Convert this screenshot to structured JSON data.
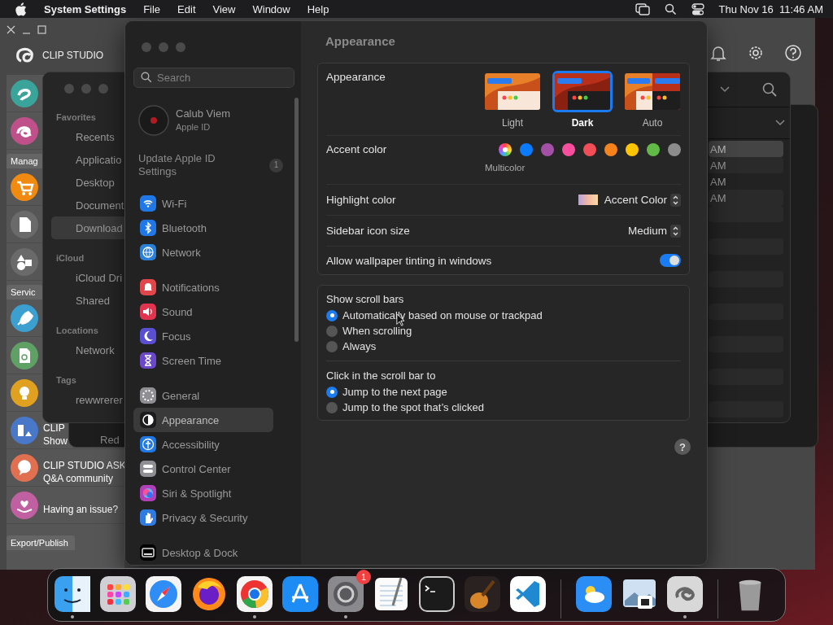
{
  "menu_bar": {
    "app": "System Settings",
    "menus": [
      "File",
      "Edit",
      "View",
      "Window",
      "Help"
    ],
    "clock": "Thu Nov 16  11:46 AM"
  },
  "clip_studio": {
    "title": "CLIP STUDIO",
    "items": [
      {
        "kind": "app"
      },
      {
        "kind": "app"
      },
      {
        "kind": "tab",
        "label": "Manag"
      },
      {
        "kind": "app"
      },
      {
        "kind": "app"
      },
      {
        "kind": "app"
      },
      {
        "kind": "tab",
        "label": "Servic"
      },
      {
        "kind": "app"
      },
      {
        "kind": "app"
      },
      {
        "kind": "app"
      },
      {
        "kind": "entry",
        "title": "CLIP",
        "subtitle": "Show"
      },
      {
        "kind": "entry",
        "title": "CLIP STUDIO ASK",
        "subtitle": "Q&A community"
      },
      {
        "kind": "entry",
        "title": "Having an issue?"
      },
      {
        "kind": "tab",
        "label": "Export/Publish"
      }
    ]
  },
  "finder": {
    "sections": [
      {
        "title": "Favorites",
        "items": [
          {
            "label": "Recents",
            "selected": false
          },
          {
            "label": "Applicatio",
            "selected": false
          },
          {
            "label": "Desktop",
            "selected": false
          },
          {
            "label": "Document",
            "selected": false
          },
          {
            "label": "Download",
            "selected": true
          }
        ]
      },
      {
        "title": "iCloud",
        "items": [
          {
            "label": "iCloud Dri",
            "selected": false
          },
          {
            "label": "Shared",
            "selected": false
          }
        ]
      },
      {
        "title": "Locations",
        "items": [
          {
            "label": "Network",
            "selected": false
          }
        ]
      },
      {
        "title": "Tags",
        "items": [
          {
            "label": "rewwrerer",
            "selected": false
          }
        ]
      }
    ],
    "rows": [
      {
        "text": "AM",
        "selected": true
      },
      {
        "text": "AM",
        "selected": false
      },
      {
        "text": "AM",
        "selected": false
      },
      {
        "text": "AM",
        "selected": false
      }
    ]
  },
  "finder_back": {
    "tag": "Red"
  },
  "settings": {
    "search": {
      "placeholder": "Search"
    },
    "account": {
      "name": "Calub Viem",
      "subtitle": "Apple ID"
    },
    "notice": {
      "text": "Update Apple ID Settings",
      "badge": "1"
    },
    "groups": [
      {
        "items": [
          {
            "label": "Wi-Fi",
            "color": "#1f78e6",
            "selected": false
          },
          {
            "label": "Bluetooth",
            "color": "#1f78e6",
            "selected": false
          },
          {
            "label": "Network",
            "color": "#2a7fd9",
            "selected": false
          }
        ]
      },
      {
        "items": [
          {
            "label": "Notifications",
            "color": "#e0464a",
            "selected": false
          },
          {
            "label": "Sound",
            "color": "#e0344f",
            "selected": false
          },
          {
            "label": "Focus",
            "color": "#5a4fd0",
            "selected": false
          },
          {
            "label": "Screen Time",
            "color": "#6a48c9",
            "selected": false
          }
        ]
      },
      {
        "items": [
          {
            "label": "General",
            "color": "#8e8e93",
            "selected": false
          },
          {
            "label": "Appearance",
            "color": "#1c1c1e",
            "selected": true
          },
          {
            "label": "Accessibility",
            "color": "#1f78e6",
            "selected": false
          },
          {
            "label": "Control Center",
            "color": "#8e8e93",
            "selected": false
          },
          {
            "label": "Siri & Spotlight",
            "color": "#b03fb8",
            "selected": false
          },
          {
            "label": "Privacy & Security",
            "color": "#2f7be0",
            "selected": false
          }
        ]
      },
      {
        "items": [
          {
            "label": "Desktop & Dock",
            "color": "#000000",
            "selected": false
          }
        ]
      }
    ],
    "help": "?",
    "page_title": "Appearance",
    "appearance": {
      "label": "Appearance",
      "options": [
        {
          "kind": "light",
          "label": "Light",
          "selected": false
        },
        {
          "kind": "dark",
          "label": "Dark",
          "selected": true
        },
        {
          "kind": "auto",
          "label": "Auto",
          "selected": false
        }
      ]
    },
    "accent": {
      "label": "Accent color",
      "colors": [
        {
          "kind": "multicolor",
          "label": "Multicolor",
          "selected": true
        },
        {
          "kind": "color",
          "color": "#0a7aff",
          "selected": false
        },
        {
          "kind": "color",
          "color": "#a550a7",
          "selected": false
        },
        {
          "kind": "color",
          "color": "#f74f9e",
          "selected": false
        },
        {
          "kind": "color",
          "color": "#f24e58",
          "selected": false
        },
        {
          "kind": "color",
          "color": "#f7821b",
          "selected": false
        },
        {
          "kind": "color",
          "color": "#ffc600",
          "selected": false
        },
        {
          "kind": "color",
          "color": "#62ba46",
          "selected": false
        },
        {
          "kind": "color",
          "color": "#8c8c8c",
          "selected": false
        }
      ]
    },
    "highlight": {
      "label": "Highlight color",
      "value": "Accent Color"
    },
    "icon_size": {
      "label": "Sidebar icon size",
      "value": "Medium"
    },
    "tinting": {
      "label": "Allow wallpaper tinting in windows",
      "on": true
    },
    "radio_groups": [
      {
        "title": "Show scroll bars",
        "options": [
          {
            "label": "Automatically based on mouse or trackpad",
            "selected": true
          },
          {
            "label": "When scrolling",
            "selected": false
          },
          {
            "label": "Always",
            "selected": false
          }
        ]
      },
      {
        "title": "Click in the scroll bar to",
        "options": [
          {
            "label": "Jump to the next page",
            "selected": true
          },
          {
            "label": "Jump to the spot that’s clicked",
            "selected": false
          }
        ]
      }
    ]
  },
  "dock": {
    "apps": [
      {
        "running": true
      },
      {
        "running": false
      },
      {
        "running": false
      },
      {
        "running": false
      },
      {
        "running": true
      },
      {
        "running": false
      },
      {
        "running": true,
        "badge": "1"
      },
      {
        "running": false
      },
      {
        "running": false
      },
      {
        "running": false
      },
      {
        "running": false
      }
    ],
    "recent": [
      {
        "running": false
      },
      {
        "running": false
      },
      {
        "running": true
      }
    ]
  }
}
